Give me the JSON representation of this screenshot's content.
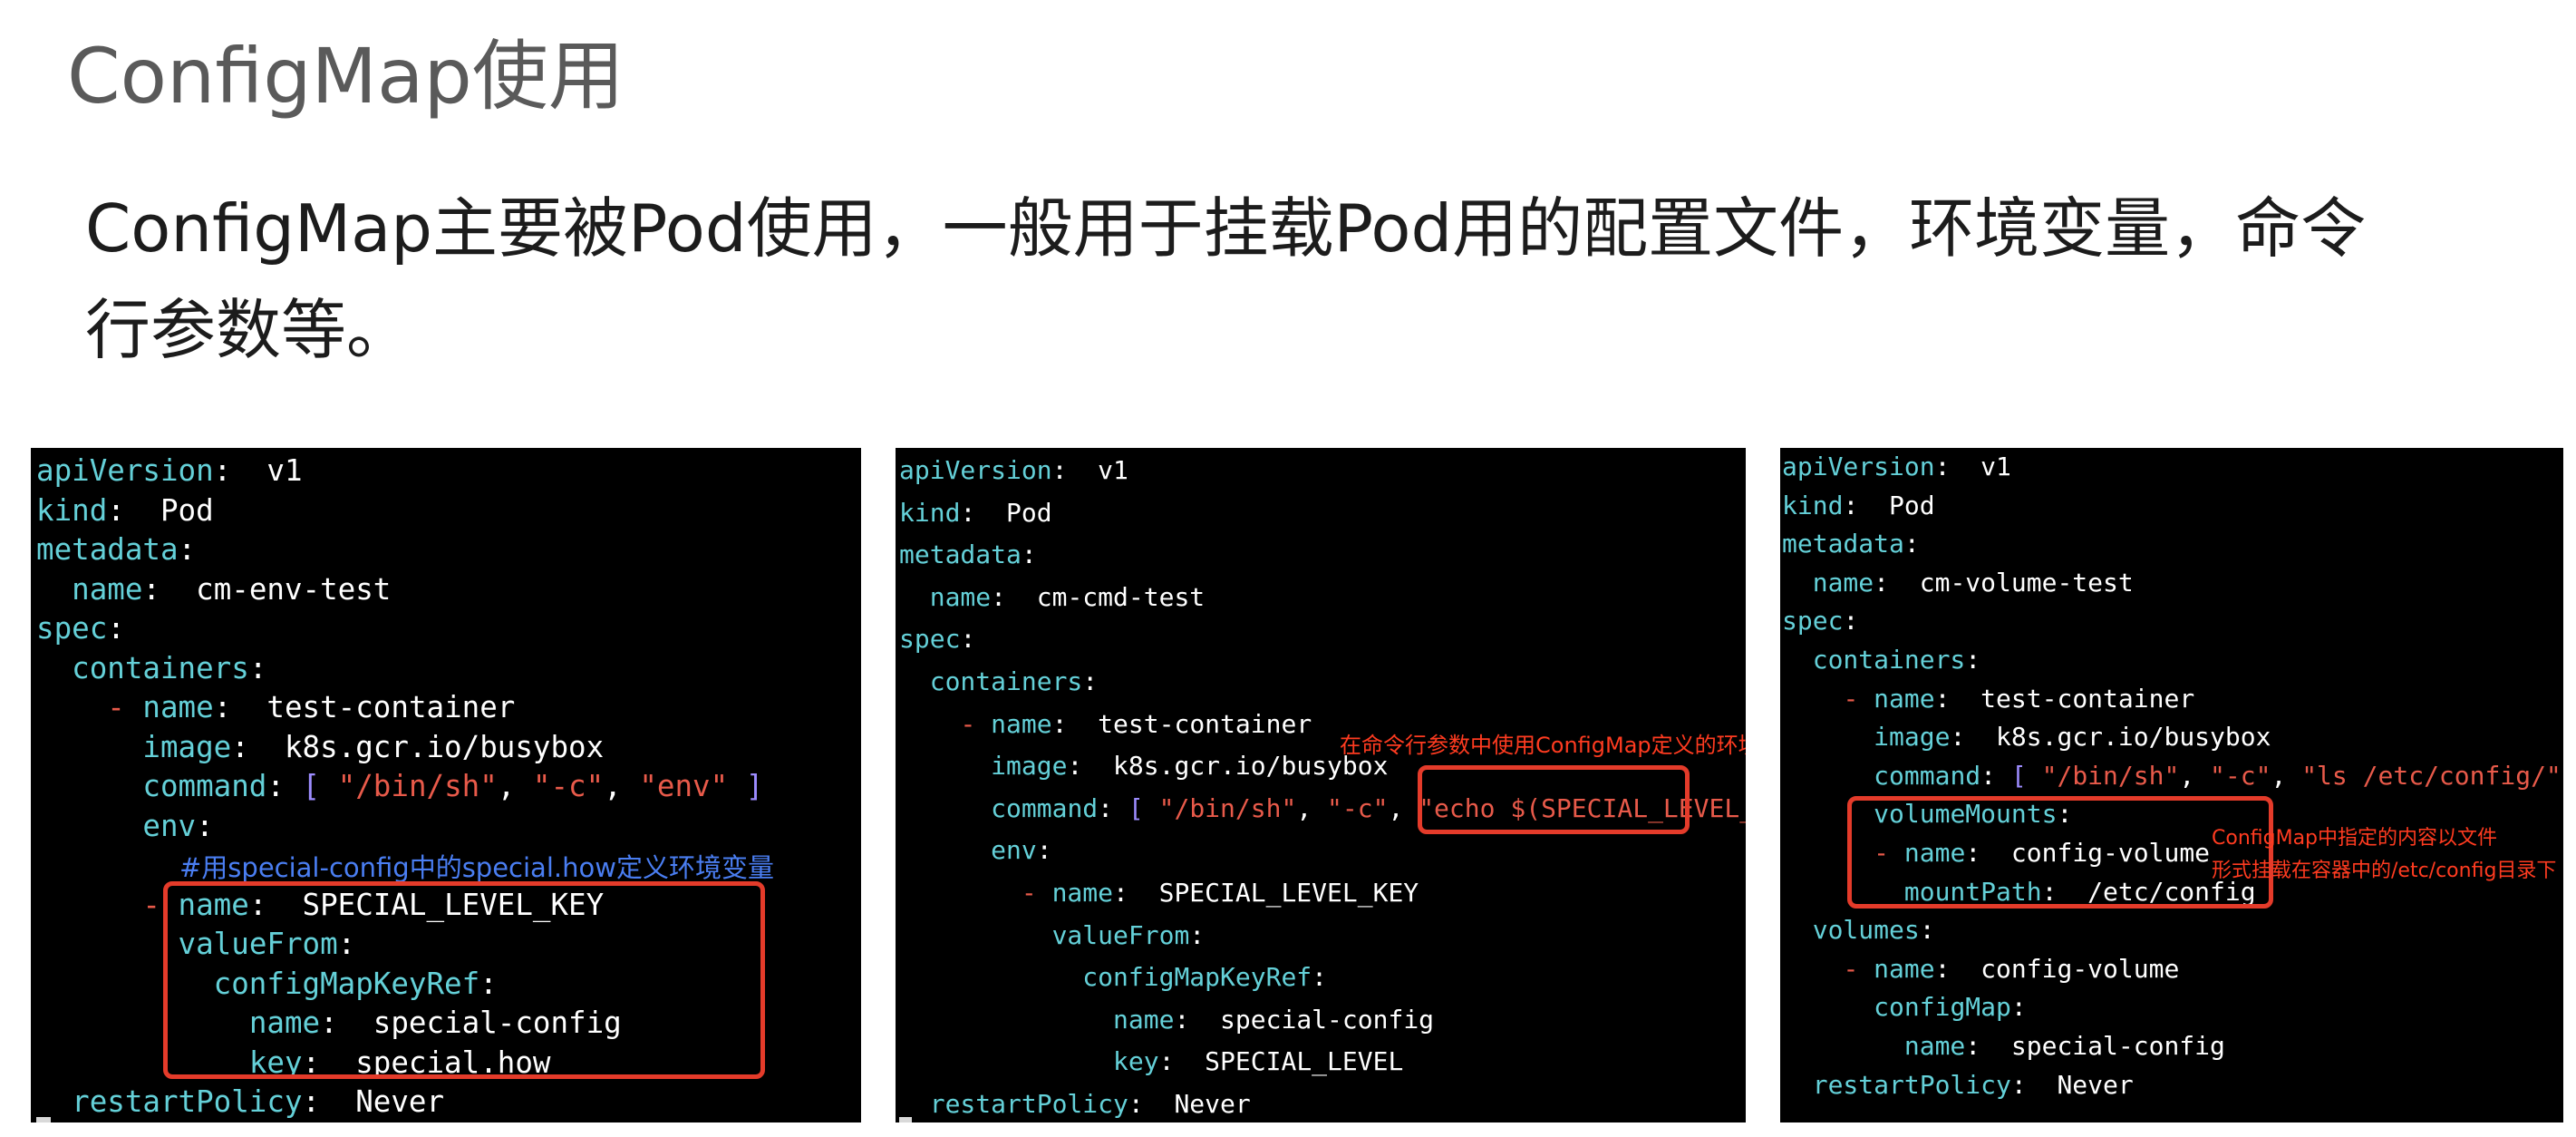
{
  "page": {
    "title": "ConfigMap使用",
    "description_line1": "ConfigMap主要被Pod使用，一般用于挂载Pod用的配置文件，环境变量，命令",
    "description_line2": "行参数等。"
  },
  "panel1": {
    "l1k": "apiVersion",
    "l1v": " v1",
    "l2k": "kind",
    "l2v": " Pod",
    "l3k": "metadata",
    "l4k": "name",
    "l4v": " cm-env-test",
    "l5k": "spec",
    "l6k": "containers",
    "l7k": "name",
    "l7v": " test-container",
    "l8k": "image",
    "l8v": " k8s.gcr.io/busybox",
    "l9k": "command",
    "l9a": "\"/bin/sh\"",
    "l9b": "\"-c\"",
    "l9c": "\"env\"",
    "l10k": "env",
    "comment": "#用special-config中的special.how定义环境变量",
    "l12k": "name",
    "l12v": " SPECIAL_LEVEL_KEY",
    "l13k": "valueFrom",
    "l14k": "configMapKeyRef",
    "l15k": "name",
    "l15v": " special-config",
    "l16k": "key",
    "l16v": " special.how",
    "l17k": "restartPolicy",
    "l17v": " Never"
  },
  "panel2": {
    "l1k": "apiVersion",
    "l1v": " v1",
    "l2k": "kind",
    "l2v": " Pod",
    "l3k": "metadata",
    "l4k": "name",
    "l4v": " cm-cmd-test",
    "l5k": "spec",
    "l6k": "containers",
    "l7k": "name",
    "l7v": " test-container",
    "l8k": "image",
    "l8v": " k8s.gcr.io/busybox",
    "l9k": "command",
    "l9a": "\"/bin/sh\"",
    "l9b": "\"-c\"",
    "l9c": "\"echo ",
    "l9d": "$(SPECIAL_LEVEL_KEY)",
    "l9e": "\"",
    "l10k": "env",
    "l11k": "name",
    "l11v": " SPECIAL_LEVEL_KEY",
    "l12k": "valueFrom",
    "l13k": "configMapKeyRef",
    "l14k": "name",
    "l14v": " special-config",
    "l15k": "key",
    "l15v": " SPECIAL_LEVEL",
    "l16k": "restartPolicy",
    "l16v": " Never",
    "annotation": "在命令行参数中使用ConfigMap定义的环境变量"
  },
  "panel3": {
    "l1k": "apiVersion",
    "l1v": " v1",
    "l2k": "kind",
    "l2v": " Pod",
    "l3k": "metadata",
    "l4k": "name",
    "l4v": " cm-volume-test",
    "l5k": "spec",
    "l6k": "containers",
    "l7k": "name",
    "l7v": " test-container",
    "l8k": "image",
    "l8v": " k8s.gcr.io/busybox",
    "l9k": "command",
    "l9a": "\"/bin/sh\"",
    "l9b": "\"-c\"",
    "l9c": "\"ls /etc/config/\"",
    "l10k": "volumeMounts",
    "l11k": "name",
    "l11v": " config-volume",
    "l12k": "mountPath",
    "l12v": " /etc/config",
    "l13k": "volumes",
    "l14k": "name",
    "l14v": " config-volume",
    "l15k": "configMap",
    "l16k": "name",
    "l16v": " special-config",
    "l17k": "restartPolicy",
    "l17v": " Never",
    "annotation1": "ConfigMap中指定的内容以文件",
    "annotation2": "形式挂载在容器中的/etc/config目录下"
  }
}
